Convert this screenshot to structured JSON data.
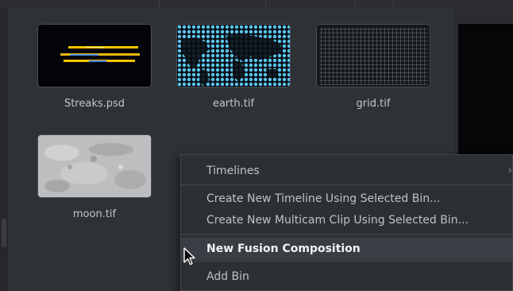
{
  "clips": [
    {
      "name": "Streaks.psd",
      "thumb_icon": "streaks-thumbnail"
    },
    {
      "name": "earth.tif",
      "thumb_icon": "earth-map-thumbnail"
    },
    {
      "name": "grid.tif",
      "thumb_icon": "grid-thumbnail"
    },
    {
      "name": "moon.tif",
      "thumb_icon": "moon-texture-thumbnail"
    }
  ],
  "context_menu": {
    "timelines": "Timelines",
    "submenu_arrow": "›",
    "create_timeline": "Create New Timeline Using Selected Bin...",
    "create_multicam": "Create New Multicam Clip Using Selected Bin...",
    "new_fusion": "New Fusion Composition",
    "add_bin": "Add Bin"
  },
  "colors": {
    "bin_background": "#2e3136",
    "menu_background": "#2c2f34",
    "menu_highlight": "#3a3d43",
    "streak_yellow": "#f5c400",
    "streak_blue": "#3a8ee8",
    "earth_dots": "#5bc6ef"
  }
}
